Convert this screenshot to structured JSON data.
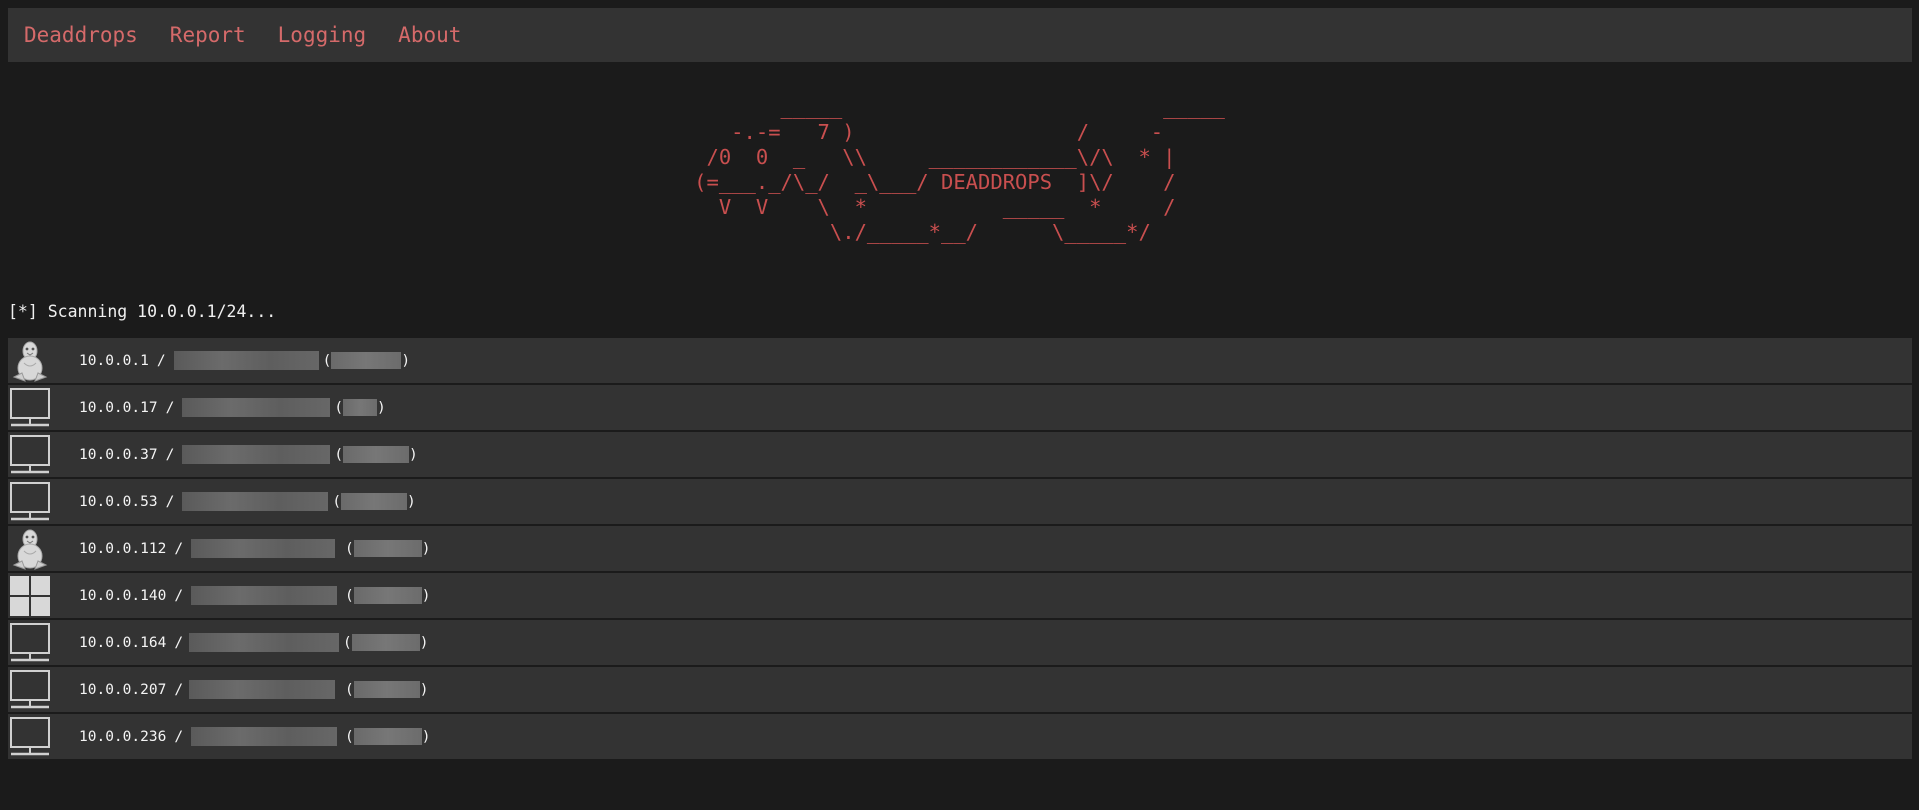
{
  "nav": {
    "items": [
      {
        "label": "Deaddrops"
      },
      {
        "label": "Report"
      },
      {
        "label": "Logging"
      },
      {
        "label": "About"
      }
    ]
  },
  "banner": {
    "ascii": "       _____                          _____\n   -.-=   7 )                  /     -\n /0  0  _   \\\\     ____________\\/\\  * |\n(=___._/\\_/  _\\___/ DEADDROPS  ]\\/    /\n  V  V    \\  *           _____  *     /\n           \\./_____*__/      \\_____*/"
  },
  "scan": {
    "status": "[*] Scanning 10.0.0.1/24..."
  },
  "hosts": [
    {
      "ip": "10.0.0.1",
      "icon": "linux-tux-icon",
      "open_paren": "(",
      "close_paren": ")"
    },
    {
      "ip": "10.0.0.17",
      "icon": "monitor-icon",
      "open_paren": "(",
      "close_paren": ")"
    },
    {
      "ip": "10.0.0.37",
      "icon": "monitor-icon",
      "open_paren": "(",
      "close_paren": ")"
    },
    {
      "ip": "10.0.0.53",
      "icon": "monitor-icon",
      "open_paren": "(",
      "close_paren": ")"
    },
    {
      "ip": "10.0.0.112",
      "icon": "linux-tux-icon",
      "open_paren": "(",
      "close_paren": ")"
    },
    {
      "ip": "10.0.0.140",
      "icon": "windows-icon",
      "open_paren": "(",
      "close_paren": ")"
    },
    {
      "ip": "10.0.0.164",
      "icon": "monitor-icon",
      "open_paren": "(",
      "close_paren": ")"
    },
    {
      "ip": "10.0.0.207",
      "icon": "monitor-icon",
      "open_paren": "(",
      "close_paren": ")"
    },
    {
      "ip": "10.0.0.236",
      "icon": "monitor-icon",
      "open_paren": "(",
      "close_paren": ")"
    }
  ],
  "separator": "/",
  "colors": {
    "accent": "#d56a6a",
    "banner": "#c94f4f",
    "background": "#1b1b1b",
    "row": "#333333"
  }
}
